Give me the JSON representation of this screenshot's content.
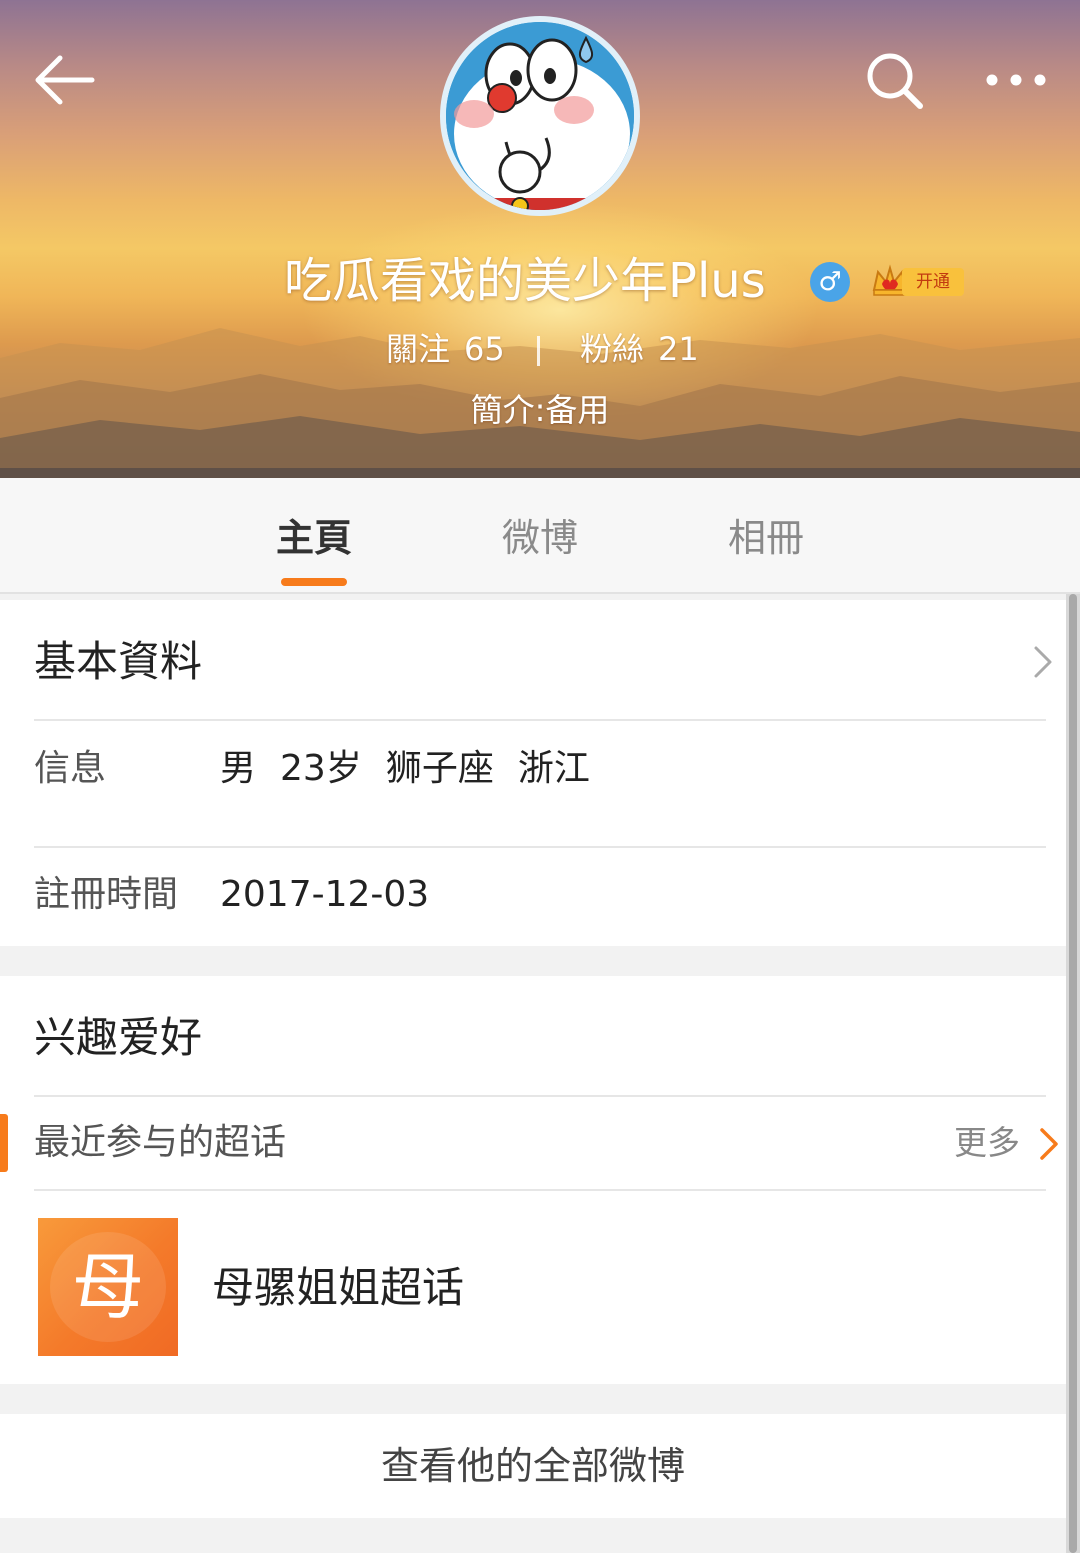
{
  "header": {
    "username": "吃瓜看戏的美少年Plus",
    "gender_icon": "male-icon",
    "gender_symbol": "♂",
    "vip_label": "开通",
    "following_label": "關注",
    "following_count": "65",
    "followers_label": "粉絲",
    "followers_count": "21",
    "bio": "簡介:备用",
    "icons": {
      "back": "back-arrow-icon",
      "search": "search-icon",
      "more": "more-dots-icon"
    }
  },
  "tabs": [
    {
      "label": "主頁",
      "active": true
    },
    {
      "label": "微博",
      "active": false
    },
    {
      "label": "相冊",
      "active": false
    }
  ],
  "basic_info": {
    "title": "基本資料",
    "info_label": "信息",
    "info_values": [
      "男",
      "23岁",
      "狮子座",
      "浙江"
    ],
    "register_label": "註冊時間",
    "register_value": "2017-12-03"
  },
  "interests": {
    "title": "兴趣爱好",
    "recent_topics_label": "最近参与的超话",
    "more_label": "更多",
    "topic": {
      "thumb_char": "母",
      "name": "母骡姐姐超话"
    }
  },
  "footer": {
    "view_all": "查看他的全部微博"
  },
  "colors": {
    "accent": "#f77b1b",
    "male_blue": "#4aa4e8",
    "vip_gold": "#f9c13c"
  }
}
